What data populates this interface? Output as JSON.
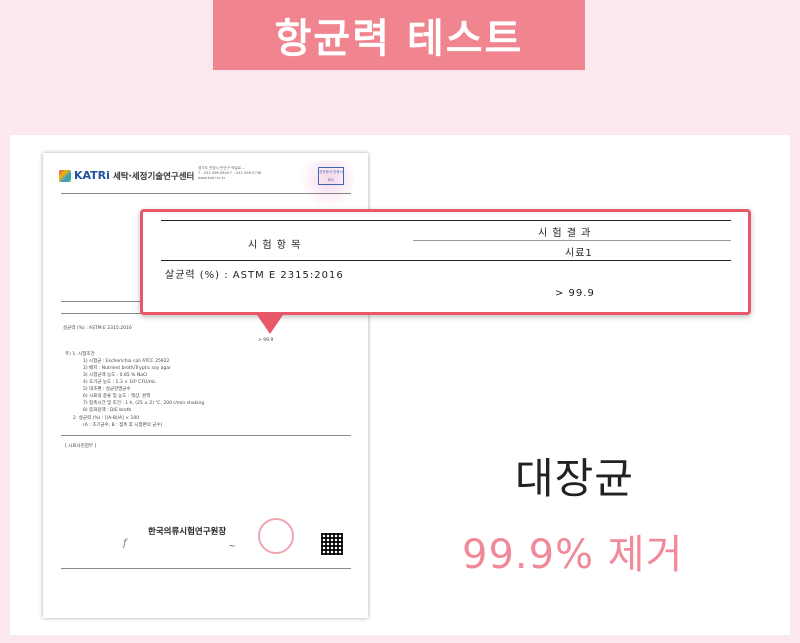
{
  "header": {
    "title": "항균력 테스트"
  },
  "document": {
    "logo_brand": "KATRi",
    "logo_name": "세탁·세정기술연구센터",
    "address_lines": [
      "경기도 안양시 만안구 박달로 ...",
      "T : 031-596-5800  F : 031-596-5706",
      "www.katri.re.kr"
    ],
    "cert_badge": "전자문서 인증서비스",
    "test_item_row": "살균력 (%) : ASTM E 2315:2016",
    "result_value": "> 99.9",
    "lab_name": "한국의류시험연구원장",
    "notes": [
      "주) 1. 시험조건",
      "1) 시험균 : Escherichia coli ATCC 25922",
      "2) 배지 : Nutrient broth/Tryptic soy agar",
      "3) 시험균액 농도 : 0.85 % NaCl",
      "4) 초기균 농도 : 1.3 × 10⁵ CFU/mL",
      "5) 대조편 : 살균한멸균수",
      "6) 시료의 종류 및 농도 : 액상, 원액",
      "7) 접촉시간 및 조건 : 1 h, (25 ± 2) ℃, 200 r/min shaking",
      "8) 중화용액 : D/E broth",
      "2. 살균력 (%) : [(A-B)/A] × 100",
      "(A : 초기균수, B : 접촉 후 시험편의 균수)"
    ],
    "footer_note": "[ 시료사진첨부 ]"
  },
  "zoom": {
    "col_item": "시 험 항 목",
    "col_result": "시 험 결 과",
    "sample_label": "시료1",
    "row_label": "살균력 (%) : ASTM E 2315:2016",
    "row_value": "> 99.9"
  },
  "summary": {
    "organism": "대장균",
    "result": "99.9% 제거"
  },
  "colors": {
    "accent": "#f0858f",
    "frame": "#e8586a",
    "result_text": "#f08a9a",
    "background": "#fbe8ec"
  }
}
